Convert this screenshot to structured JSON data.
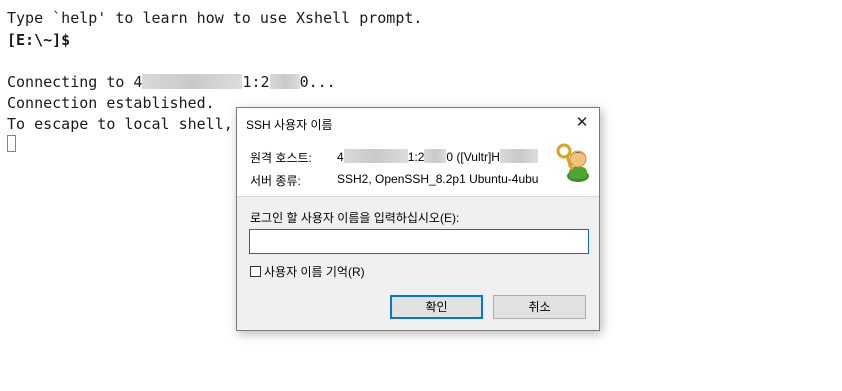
{
  "terminal": {
    "line1": "Type `help' to learn how to use Xshell prompt.",
    "prompt": "[E:\\~]$",
    "connecting_prefix": "Connecting to 4",
    "connecting_mid": "1:2",
    "connecting_suffix": "0...",
    "established": "Connection established.",
    "escape": "To escape to local shell,"
  },
  "dialog": {
    "title": "SSH 사용자 이름",
    "close_glyph": "✕",
    "host_label": "원격 호스트:",
    "host_value_a": "4",
    "host_value_b": "1:2",
    "host_value_c": "0 ([Vultr]",
    "host_value_d": "H",
    "server_label": "서버 종류:",
    "server_value": "SSH2, OpenSSH_8.2p1 Ubuntu-4ubu",
    "prompt_label": "로그인 할 사용자 이름을 입력하십시오(E):",
    "input_value": "",
    "remember_label": "사용자 이름 기억(R)",
    "remember_checked": false,
    "ok_label": "확인",
    "cancel_label": "취소",
    "icon": "user-key-icon",
    "accent_color": "#0078d7"
  }
}
